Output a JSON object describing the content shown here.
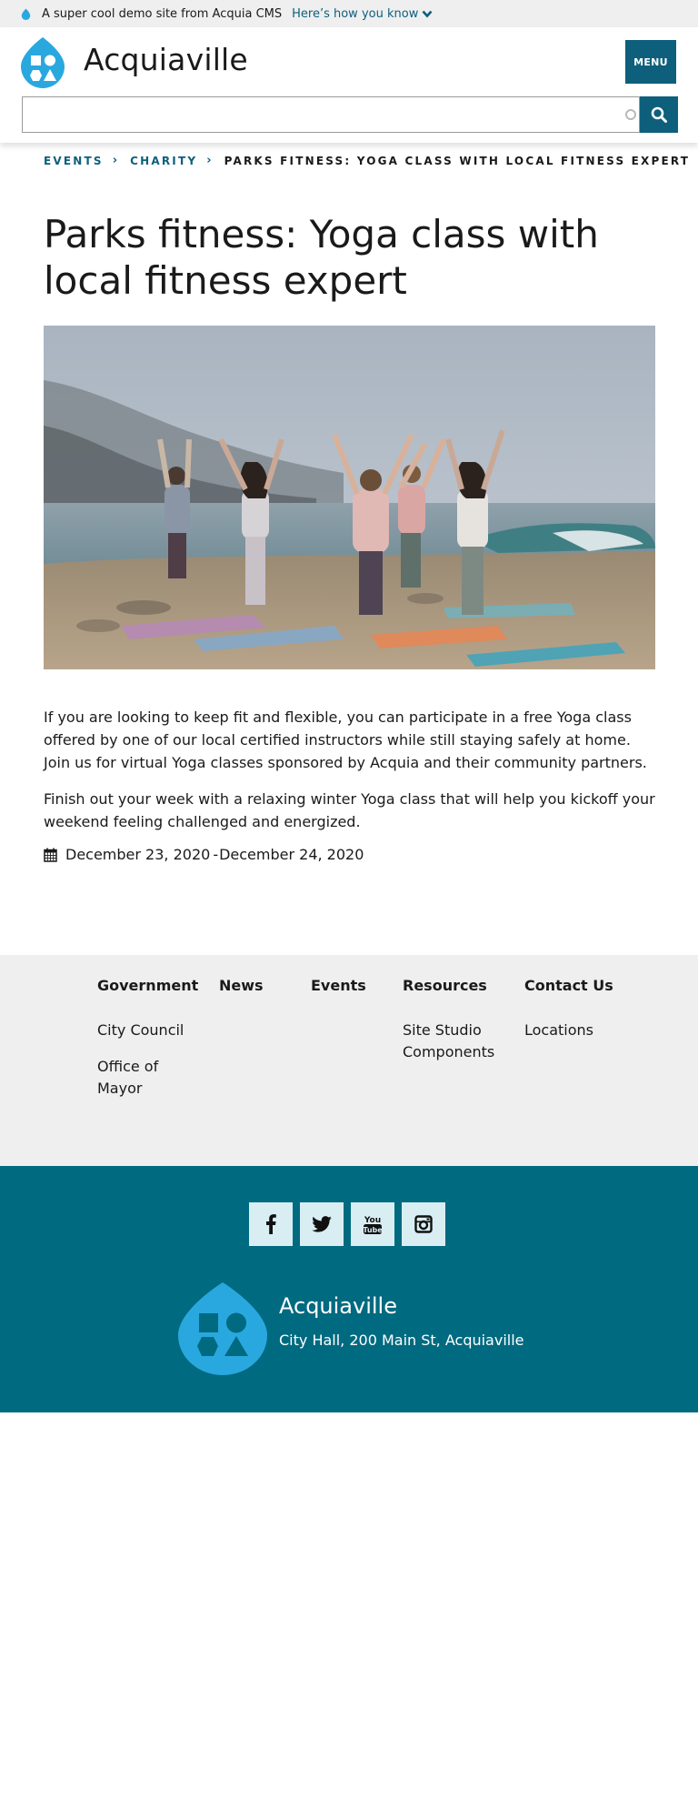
{
  "demo_bar": {
    "text": "A super cool demo site from Acquia CMS",
    "link_label": "Here’s how you know"
  },
  "header": {
    "site_name": "Acquiaville",
    "menu_label": "MENU",
    "search_value": "",
    "search_placeholder": ""
  },
  "breadcrumb": {
    "items": [
      "EVENTS",
      "CHARITY"
    ],
    "current": "PARKS FITNESS: YOGA CLASS WITH LOCAL FITNESS EXPERT"
  },
  "page": {
    "title": "Parks fitness: Yoga class with local fitness expert",
    "paragraphs": [
      "If you are looking to keep fit and flexible, you can participate in a free Yoga class offered by one of our local certified instructors while still staying safely at home. Join us for virtual Yoga classes sponsored by Acquia and their community partners.",
      "Finish out your week with a relaxing winter Yoga class that will help you kickoff your weekend feeling challenged and energized."
    ],
    "date_start": "December 23, 2020",
    "date_separator": "-",
    "date_end": "December 24, 2020",
    "date_icon": "calendar-icon"
  },
  "footer_nav": {
    "columns": [
      {
        "heading": "Government",
        "links": [
          "City Council",
          "Office of Mayor"
        ]
      },
      {
        "heading": "News",
        "links": []
      },
      {
        "heading": "Events",
        "links": []
      },
      {
        "heading": "Resources",
        "links": [
          "Site Studio Components"
        ]
      },
      {
        "heading": "Contact Us",
        "links": [
          "Locations"
        ]
      }
    ]
  },
  "footer": {
    "social": [
      "facebook-icon",
      "twitter-icon",
      "youtube-icon",
      "instagram-icon"
    ],
    "youtube_text_top": "You",
    "youtube_text_bottom": "Tube",
    "site_name": "Acquiaville",
    "address": "City Hall, 200 Main St, Acquiaville"
  },
  "colors": {
    "brand_teal": "#0d5f7c",
    "footer_teal": "#006a80",
    "logo_blue": "#29a8e0",
    "demo_bar_bg": "#efefef",
    "footer_nav_bg": "#efefef",
    "social_bg": "#d9eef3"
  }
}
